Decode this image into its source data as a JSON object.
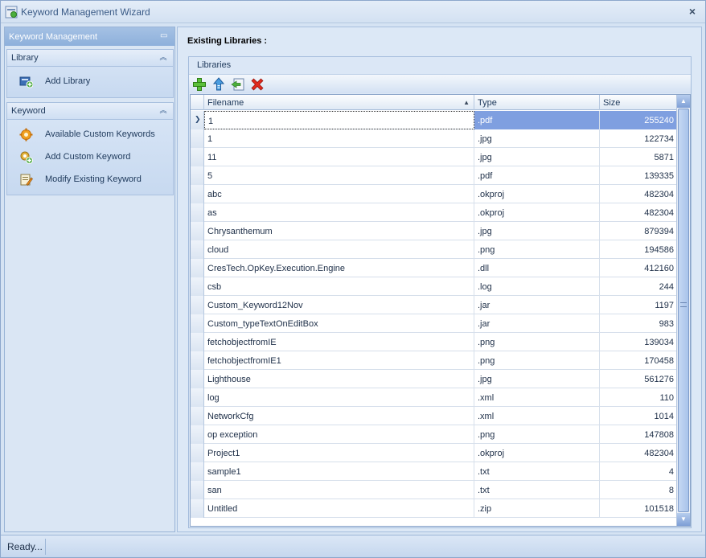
{
  "window": {
    "title": "Keyword Management Wizard",
    "close_label": "×"
  },
  "sidebar": {
    "header": "Keyword Management",
    "groups": [
      {
        "title": "Library",
        "items": [
          {
            "label": "Add Library",
            "icon": "add-library-icon"
          }
        ]
      },
      {
        "title": "Keyword",
        "items": [
          {
            "label": "Available Custom Keywords",
            "icon": "available-keywords-icon"
          },
          {
            "label": "Add Custom Keyword",
            "icon": "add-keyword-icon"
          },
          {
            "label": "Modify Existing  Keyword",
            "icon": "modify-keyword-icon"
          }
        ]
      }
    ]
  },
  "main": {
    "section_title": "Existing Libraries :",
    "group_label": "Libraries",
    "toolbar": [
      "add-icon",
      "upload-icon",
      "import-icon",
      "delete-icon"
    ],
    "columns": [
      "Filename",
      "Type",
      "Size"
    ],
    "rows": [
      {
        "name": "1",
        "type": ".pdf",
        "size": "255240"
      },
      {
        "name": "1",
        "type": ".jpg",
        "size": "122734"
      },
      {
        "name": "11",
        "type": ".jpg",
        "size": "5871"
      },
      {
        "name": "5",
        "type": ".pdf",
        "size": "139335"
      },
      {
        "name": "abc",
        "type": ".okproj",
        "size": "482304"
      },
      {
        "name": "as",
        "type": ".okproj",
        "size": "482304"
      },
      {
        "name": "Chrysanthemum",
        "type": ".jpg",
        "size": "879394"
      },
      {
        "name": "cloud",
        "type": ".png",
        "size": "194586"
      },
      {
        "name": "CresTech.OpKey.Execution.Engine",
        "type": ".dll",
        "size": "412160"
      },
      {
        "name": "csb",
        "type": ".log",
        "size": "244"
      },
      {
        "name": "Custom_Keyword12Nov",
        "type": ".jar",
        "size": "1197"
      },
      {
        "name": "Custom_typeTextOnEditBox",
        "type": ".jar",
        "size": "983"
      },
      {
        "name": "fetchobjectfromIE",
        "type": ".png",
        "size": "139034"
      },
      {
        "name": "fetchobjectfromIE1",
        "type": ".png",
        "size": "170458"
      },
      {
        "name": "Lighthouse",
        "type": ".jpg",
        "size": "561276"
      },
      {
        "name": "log",
        "type": ".xml",
        "size": "110"
      },
      {
        "name": "NetworkCfg",
        "type": ".xml",
        "size": "1014"
      },
      {
        "name": "op exception",
        "type": ".png",
        "size": "147808"
      },
      {
        "name": "Project1",
        "type": ".okproj",
        "size": "482304"
      },
      {
        "name": "sample1",
        "type": ".txt",
        "size": "4"
      },
      {
        "name": "san",
        "type": ".txt",
        "size": "8"
      },
      {
        "name": "Untitled",
        "type": ".zip",
        "size": "101518"
      }
    ],
    "selected_row": 0
  },
  "status": {
    "text": "Ready..."
  }
}
